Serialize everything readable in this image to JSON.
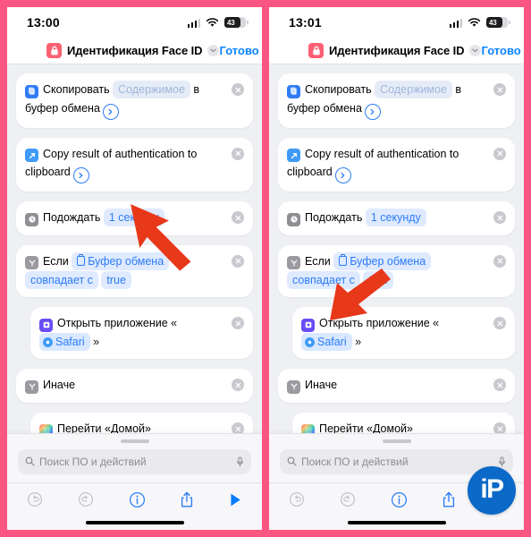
{
  "theme": {
    "frame_pink": "#fb5581",
    "accent_blue": "#0a84ff",
    "chip_blue_bg": "#dfeaff",
    "chip_blue_text": "#2b7cf6",
    "arrow_red": "#e8381a",
    "badge_blue": "#0b69c7",
    "screen_bg": "#eff0f4"
  },
  "panels": [
    {
      "id": "left",
      "status": {
        "time": "13:00",
        "battery_level": "43",
        "signal_icon": "cellular-bars-icon",
        "wifi_icon": "wifi-icon",
        "battery_icon": "battery-icon"
      },
      "navbar": {
        "lock_icon": "lock-icon",
        "title": "Идентификация Face ID",
        "chevron_icon": "chevron-down-icon",
        "done_label": "Готово"
      },
      "search": {
        "placeholder": "Поиск ПО и действий",
        "search_icon": "search-icon",
        "mic_icon": "microphone-icon"
      },
      "toolbar": {
        "undo_icon": "undo-icon",
        "redo_icon": "redo-icon",
        "info_icon": "info-icon",
        "share_icon": "share-icon",
        "play_icon": "play-icon"
      },
      "show_badge": false,
      "badge_label": "",
      "arrow": {
        "visible": true,
        "target": "wait-duration-chip"
      }
    },
    {
      "id": "right",
      "status": {
        "time": "13:01",
        "battery_level": "43",
        "signal_icon": "cellular-bars-icon",
        "wifi_icon": "wifi-icon",
        "battery_icon": "battery-icon"
      },
      "navbar": {
        "lock_icon": "lock-icon",
        "title": "Идентификация Face ID",
        "chevron_icon": "chevron-down-icon",
        "done_label": "Готово"
      },
      "search": {
        "placeholder": "Поиск ПО и действий",
        "search_icon": "search-icon",
        "mic_icon": "microphone-icon"
      },
      "toolbar": {
        "undo_icon": "undo-icon",
        "redo_icon": "redo-icon",
        "info_icon": "info-icon",
        "share_icon": "share-icon",
        "play_icon": "play-icon"
      },
      "show_badge": true,
      "badge_label": "iP",
      "arrow": {
        "visible": true,
        "target": "open-app-safari-chip"
      }
    }
  ],
  "actions": [
    {
      "key": "copy-to-clipboard",
      "icon": "clipboard-copy-icon",
      "text_1": "Скопировать",
      "chip_1": "Содержимое",
      "text_2": "в буфер обмена",
      "has_expand_arrow": true,
      "indent": false,
      "delete_icon": "remove-icon"
    },
    {
      "key": "copy-result-of-authentication",
      "icon": "shortcut-arrow-icon",
      "text_1": "Copy result of authentication to clipboard",
      "chip_1": "",
      "text_2": "",
      "has_expand_arrow": true,
      "indent": false,
      "delete_icon": "remove-icon"
    },
    {
      "key": "wait",
      "icon": "clock-icon",
      "text_1": "Подождать",
      "chip_1": "1 секунду",
      "text_2": "",
      "has_expand_arrow": false,
      "indent": false,
      "delete_icon": "remove-icon"
    },
    {
      "key": "if-condition",
      "icon": "if-branch-icon",
      "text_1": "Если",
      "chip_1": "Буфер обмена",
      "chip_2": "совпадает с",
      "chip_3": "true",
      "text_2": "",
      "has_expand_arrow": false,
      "indent": false,
      "delete_icon": "remove-icon"
    },
    {
      "key": "open-app",
      "icon": "open-app-icon",
      "text_1": "Открыть приложение",
      "quote_open": "«",
      "chip_1": "Safari",
      "quote_close": "»",
      "text_2": "",
      "has_expand_arrow": false,
      "indent": true,
      "delete_icon": "remove-icon"
    },
    {
      "key": "otherwise",
      "icon": "if-branch-icon",
      "text_1": "Иначе",
      "chip_1": "",
      "text_2": "",
      "has_expand_arrow": false,
      "indent": false,
      "delete_icon": "remove-icon"
    },
    {
      "key": "go-home",
      "icon": "home-screen-icon",
      "text_1": "Перейти «Домой»",
      "chip_1": "",
      "text_2": "",
      "has_expand_arrow": false,
      "indent": true,
      "delete_icon": "remove-icon"
    }
  ]
}
